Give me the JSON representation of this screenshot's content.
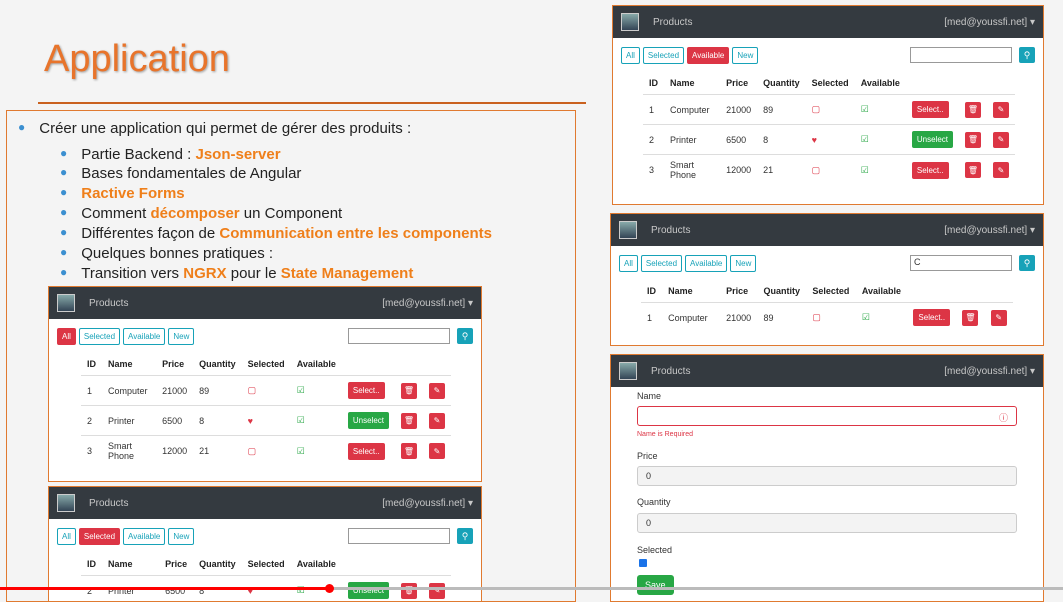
{
  "slide": {
    "title": "Application",
    "main_bullet": "Créer une application qui permet de gérer des produits :",
    "items": [
      {
        "pre": "Partie Backend : ",
        "hl": "Json-server",
        "post": ""
      },
      {
        "pre": "Bases fondamentales de Angular",
        "hl": "",
        "post": ""
      },
      {
        "pre": "",
        "hl": "Ractive Forms",
        "post": ""
      },
      {
        "pre": "Comment ",
        "hl": "décomposer",
        "post": " un Component"
      },
      {
        "pre": "Différentes façon de ",
        "hl": "Communication entre les components",
        "post": ""
      },
      {
        "pre": "Quelques bonnes pratiques :",
        "hl": "",
        "post": ""
      },
      {
        "pre": "Transition vers ",
        "hl": "NGRX",
        "post": " pour le ",
        "hl2": "State Management"
      }
    ]
  },
  "app": {
    "brand": "Products",
    "user": "[med@youssfi.net] ▾",
    "filters": [
      "All",
      "Selected",
      "Available",
      "New"
    ],
    "columns": [
      "ID",
      "Name",
      "Price",
      "Quantity",
      "Selected",
      "Available"
    ],
    "rows": [
      {
        "id": "1",
        "name": "Computer",
        "price": "21000",
        "qty": "89",
        "selected": false
      },
      {
        "id": "2",
        "name": "Printer",
        "price": "6500",
        "qty": "8",
        "selected": true
      },
      {
        "id": "3",
        "name": "Smart Phone",
        "price": "12000",
        "qty": "21",
        "selected": false
      }
    ],
    "select_label": "Select..",
    "unselect_label": "Unselect",
    "search_value_filtered": "C"
  },
  "form": {
    "name_label": "Name",
    "name_error": "Name is Required",
    "price_label": "Price",
    "price_value": "0",
    "quantity_label": "Quantity",
    "quantity_value": "0",
    "selected_label": "Selected",
    "save_label": "Save"
  }
}
